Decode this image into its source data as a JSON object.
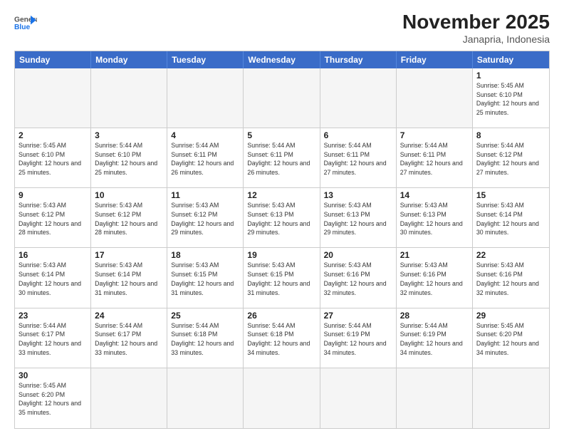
{
  "logo": {
    "text_general": "General",
    "text_blue": "Blue"
  },
  "header": {
    "month": "November 2025",
    "location": "Janapria, Indonesia"
  },
  "day_headers": [
    "Sunday",
    "Monday",
    "Tuesday",
    "Wednesday",
    "Thursday",
    "Friday",
    "Saturday"
  ],
  "weeks": [
    [
      {
        "day": null,
        "empty": true
      },
      {
        "day": null,
        "empty": true
      },
      {
        "day": null,
        "empty": true
      },
      {
        "day": null,
        "empty": true
      },
      {
        "day": null,
        "empty": true
      },
      {
        "day": null,
        "empty": true
      },
      {
        "day": 1,
        "sunrise": "5:45 AM",
        "sunset": "6:10 PM",
        "daylight": "12 hours and 25 minutes."
      }
    ],
    [
      {
        "day": 2,
        "sunrise": "5:45 AM",
        "sunset": "6:10 PM",
        "daylight": "12 hours and 25 minutes."
      },
      {
        "day": 3,
        "sunrise": "5:44 AM",
        "sunset": "6:10 PM",
        "daylight": "12 hours and 25 minutes."
      },
      {
        "day": 4,
        "sunrise": "5:44 AM",
        "sunset": "6:11 PM",
        "daylight": "12 hours and 26 minutes."
      },
      {
        "day": 5,
        "sunrise": "5:44 AM",
        "sunset": "6:11 PM",
        "daylight": "12 hours and 26 minutes."
      },
      {
        "day": 6,
        "sunrise": "5:44 AM",
        "sunset": "6:11 PM",
        "daylight": "12 hours and 27 minutes."
      },
      {
        "day": 7,
        "sunrise": "5:44 AM",
        "sunset": "6:11 PM",
        "daylight": "12 hours and 27 minutes."
      },
      {
        "day": 8,
        "sunrise": "5:44 AM",
        "sunset": "6:12 PM",
        "daylight": "12 hours and 27 minutes."
      }
    ],
    [
      {
        "day": 9,
        "sunrise": "5:43 AM",
        "sunset": "6:12 PM",
        "daylight": "12 hours and 28 minutes."
      },
      {
        "day": 10,
        "sunrise": "5:43 AM",
        "sunset": "6:12 PM",
        "daylight": "12 hours and 28 minutes."
      },
      {
        "day": 11,
        "sunrise": "5:43 AM",
        "sunset": "6:12 PM",
        "daylight": "12 hours and 29 minutes."
      },
      {
        "day": 12,
        "sunrise": "5:43 AM",
        "sunset": "6:13 PM",
        "daylight": "12 hours and 29 minutes."
      },
      {
        "day": 13,
        "sunrise": "5:43 AM",
        "sunset": "6:13 PM",
        "daylight": "12 hours and 29 minutes."
      },
      {
        "day": 14,
        "sunrise": "5:43 AM",
        "sunset": "6:13 PM",
        "daylight": "12 hours and 30 minutes."
      },
      {
        "day": 15,
        "sunrise": "5:43 AM",
        "sunset": "6:14 PM",
        "daylight": "12 hours and 30 minutes."
      }
    ],
    [
      {
        "day": 16,
        "sunrise": "5:43 AM",
        "sunset": "6:14 PM",
        "daylight": "12 hours and 30 minutes."
      },
      {
        "day": 17,
        "sunrise": "5:43 AM",
        "sunset": "6:14 PM",
        "daylight": "12 hours and 31 minutes."
      },
      {
        "day": 18,
        "sunrise": "5:43 AM",
        "sunset": "6:15 PM",
        "daylight": "12 hours and 31 minutes."
      },
      {
        "day": 19,
        "sunrise": "5:43 AM",
        "sunset": "6:15 PM",
        "daylight": "12 hours and 31 minutes."
      },
      {
        "day": 20,
        "sunrise": "5:43 AM",
        "sunset": "6:16 PM",
        "daylight": "12 hours and 32 minutes."
      },
      {
        "day": 21,
        "sunrise": "5:43 AM",
        "sunset": "6:16 PM",
        "daylight": "12 hours and 32 minutes."
      },
      {
        "day": 22,
        "sunrise": "5:43 AM",
        "sunset": "6:16 PM",
        "daylight": "12 hours and 32 minutes."
      }
    ],
    [
      {
        "day": 23,
        "sunrise": "5:44 AM",
        "sunset": "6:17 PM",
        "daylight": "12 hours and 33 minutes."
      },
      {
        "day": 24,
        "sunrise": "5:44 AM",
        "sunset": "6:17 PM",
        "daylight": "12 hours and 33 minutes."
      },
      {
        "day": 25,
        "sunrise": "5:44 AM",
        "sunset": "6:18 PM",
        "daylight": "12 hours and 33 minutes."
      },
      {
        "day": 26,
        "sunrise": "5:44 AM",
        "sunset": "6:18 PM",
        "daylight": "12 hours and 34 minutes."
      },
      {
        "day": 27,
        "sunrise": "5:44 AM",
        "sunset": "6:19 PM",
        "daylight": "12 hours and 34 minutes."
      },
      {
        "day": 28,
        "sunrise": "5:44 AM",
        "sunset": "6:19 PM",
        "daylight": "12 hours and 34 minutes."
      },
      {
        "day": 29,
        "sunrise": "5:45 AM",
        "sunset": "6:20 PM",
        "daylight": "12 hours and 34 minutes."
      }
    ],
    [
      {
        "day": 30,
        "sunrise": "5:45 AM",
        "sunset": "6:20 PM",
        "daylight": "12 hours and 35 minutes."
      },
      {
        "day": null,
        "empty": true
      },
      {
        "day": null,
        "empty": true
      },
      {
        "day": null,
        "empty": true
      },
      {
        "day": null,
        "empty": true
      },
      {
        "day": null,
        "empty": true
      },
      {
        "day": null,
        "empty": true
      }
    ]
  ]
}
